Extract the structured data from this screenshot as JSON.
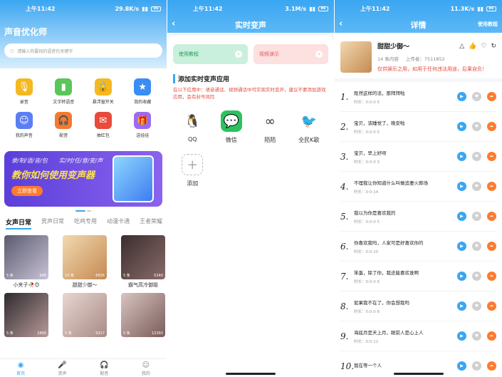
{
  "status": {
    "time": "上午11:42",
    "net1": "29.8K/s",
    "net2": "3.1M/s",
    "net3": "11.3K/s",
    "battery": "86"
  },
  "home": {
    "title": "声音优化师",
    "search_placeholder": "请输入你要找的语音包关键字",
    "grid": [
      {
        "label": "录音",
        "icon": "microphone-icon",
        "color": "#f5b820",
        "glyph": "🎙"
      },
      {
        "label": "文字转语音",
        "icon": "text-to-speech-icon",
        "color": "#59c65a",
        "glyph": "▮"
      },
      {
        "label": "悬浮窗开关",
        "icon": "lock-icon",
        "color": "#f5b820",
        "glyph": "🔒"
      },
      {
        "label": "我的收藏",
        "icon": "folder-star-icon",
        "color": "#3a8df2",
        "glyph": "★"
      },
      {
        "label": "我的声音",
        "icon": "my-voice-icon",
        "color": "#5b7ff2",
        "glyph": "☺"
      },
      {
        "label": "配音",
        "icon": "headphones-icon",
        "color": "#f57a2e",
        "glyph": "🎧"
      },
      {
        "label": "抽红包",
        "icon": "red-packet-icon",
        "color": "#e84a3b",
        "glyph": "✉"
      },
      {
        "label": "送娃娃",
        "icon": "gift-icon",
        "color": "#9c6bf2",
        "glyph": "🎁"
      }
    ],
    "banner": {
      "line1": "录/制/语/音/包　　实/时/任/意/变/声",
      "line2": "教你如何使用变声器",
      "button": "立即查看"
    },
    "tabs": [
      "女声日常",
      "男声日常",
      "吃鸡专用",
      "动漫卡通",
      "王者荣耀"
    ],
    "cards": [
      {
        "label": "小夹子🥀😊",
        "count": "5 条",
        "plays": "640",
        "bg": "linear-gradient(135deg,#5a5a6e,#c9c2d6)"
      },
      {
        "label": "甜甜少御～",
        "count": "14 条",
        "plays": "6826",
        "bg": "linear-gradient(135deg,#f3d9b0,#c48a52)"
      },
      {
        "label": "霸气高冷御姐",
        "count": "5 条",
        "plays": "5240",
        "bg": "linear-gradient(135deg,#3a2e2e,#8a6a6a)"
      },
      {
        "label": "",
        "count": "5 条",
        "plays": "2890",
        "bg": "linear-gradient(135deg,#2e2a2e,#b89a9a)"
      },
      {
        "label": "",
        "count": "5 条",
        "plays": "9317",
        "bg": "linear-gradient(135deg,#e9d6d0,#a88a86)"
      },
      {
        "label": "",
        "count": "5 条",
        "plays": "12393",
        "bg": "linear-gradient(135deg,#d8c4c0,#7a5c5a)"
      }
    ],
    "nav": [
      {
        "label": "首页",
        "icon": "home-icon",
        "glyph": "◉"
      },
      {
        "label": "变声",
        "icon": "voice-change-icon",
        "glyph": "🎤"
      },
      {
        "label": "配音",
        "icon": "dubbing-icon",
        "glyph": "🎧"
      },
      {
        "label": "我的",
        "icon": "profile-icon",
        "glyph": "☺"
      }
    ]
  },
  "realtime": {
    "title": "实时变声",
    "btn_tutorial": "使用教程",
    "btn_demo": "视频演示",
    "section": "添加实时变声应用",
    "note": "在以下应用中：语音通话、视频通话中可实现实时变声，建议不要添加游戏应用，会有封号风险",
    "apps": [
      {
        "label": "QQ",
        "icon": "qq-icon",
        "glyph": "🐧",
        "bg": "#ffffff"
      },
      {
        "label": "微信",
        "icon": "wechat-icon",
        "glyph": "💬",
        "bg": "#2dc160"
      },
      {
        "label": "陌陌",
        "icon": "momo-icon",
        "glyph": "∞",
        "bg": "#ffffff"
      },
      {
        "label": "全民K歌",
        "icon": "karaoke-icon",
        "glyph": "🐦",
        "bg": "#ffffff"
      },
      {
        "label": "添加",
        "icon": "add-icon",
        "glyph": "+",
        "bg": "#ffffff"
      }
    ]
  },
  "detail": {
    "title": "详情",
    "tutorial": "使用教程",
    "pack_name": "甜甜少御～",
    "pack_count": "14 条内容",
    "uploader": "上传者：7511852",
    "warning": "仅供娱乐之用，如用于任何违法用途，后果自负！",
    "items": [
      {
        "n": "1.",
        "text": "既然这样的话，那拜拜啦",
        "dur": "时长：0:0:0 5"
      },
      {
        "n": "2.",
        "text": "宝贝，该睡觉了，晚安啦",
        "dur": "时长：0:0:0 5"
      },
      {
        "n": "3.",
        "text": "宝贝，早上好呀",
        "dur": "时长：0:0:0 3"
      },
      {
        "n": "4.",
        "text": "不理我让你知道什么叫做追妻火葬场",
        "dur": "时长：0:0:14"
      },
      {
        "n": "5.",
        "text": "我以为你是喜欢我的",
        "dur": "时长：0:0:0 5"
      },
      {
        "n": "6.",
        "text": "你喜欢我吗，人家可是好喜欢你的",
        "dur": "时长：0:0:10"
      },
      {
        "n": "7.",
        "text": "笨蛋，除了你，我还能喜欢谁啊",
        "dur": "时长：0:0:0 6"
      },
      {
        "n": "8.",
        "text": "如果我不在了，你会想我吗",
        "dur": "时长：0:0:0 8"
      },
      {
        "n": "9.",
        "text": "海底月是天上月，眼前人是心上人",
        "dur": "时长：0:0:12"
      },
      {
        "n": "10.",
        "text": "我在等一个人",
        "dur": ""
      }
    ]
  }
}
